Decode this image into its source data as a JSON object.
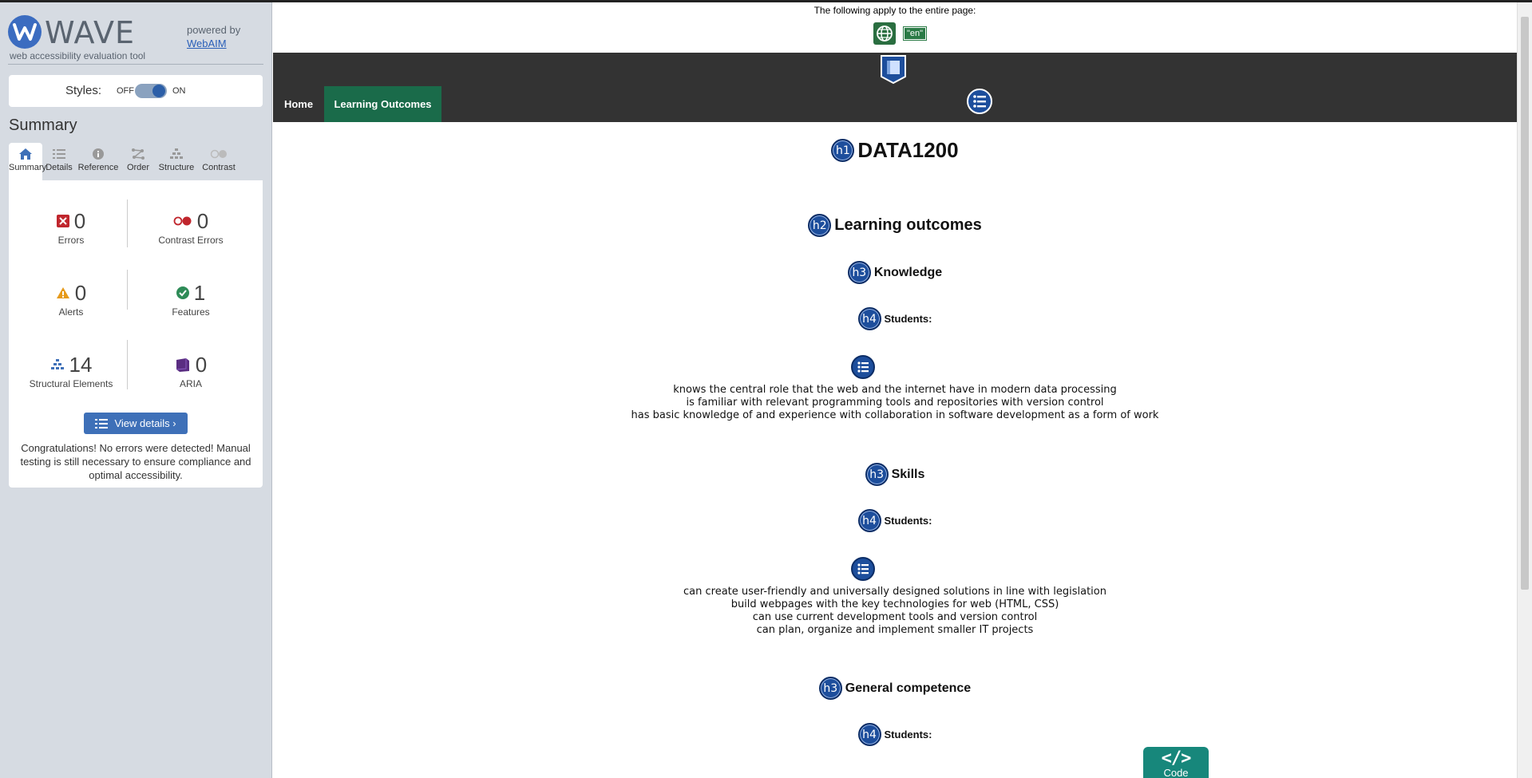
{
  "sidebar": {
    "logo_title": "WAVE",
    "logo_subtitle": "web accessibility evaluation tool",
    "powered_by": "powered by",
    "webaim_link": "WebAIM",
    "styles_label": "Styles:",
    "styles_off": "OFF",
    "styles_on": "ON",
    "summary_heading": "Summary",
    "tabs": [
      {
        "label": "Summary",
        "icon": "home-icon"
      },
      {
        "label": "Details",
        "icon": "details-list-icon"
      },
      {
        "label": "Reference",
        "icon": "info-icon"
      },
      {
        "label": "Order",
        "icon": "order-icon"
      },
      {
        "label": "Structure",
        "icon": "structure-icon"
      },
      {
        "label": "Contrast",
        "icon": "contrast-icon"
      }
    ],
    "stats": {
      "errors": {
        "value": "0",
        "label": "Errors"
      },
      "contrast_errors": {
        "value": "0",
        "label": "Contrast Errors"
      },
      "alerts": {
        "value": "0",
        "label": "Alerts"
      },
      "features": {
        "value": "1",
        "label": "Features"
      },
      "structural": {
        "value": "14",
        "label": "Structural Elements"
      },
      "aria": {
        "value": "0",
        "label": "ARIA"
      }
    },
    "view_details": "View details ›",
    "congrats": "Congratulations! No errors were detected! Manual testing is still necessary to ensure compliance and optimal accessibility."
  },
  "page": {
    "lang_notice": "The following apply to the entire page:",
    "lang_badge": "\"en\"",
    "nav": {
      "home": "Home",
      "learning_outcomes": "Learning Outcomes"
    },
    "h1": {
      "badge": "h1",
      "text": "DATA1200"
    },
    "h2": {
      "badge": "h2",
      "text": "Learning outcomes"
    },
    "knowledge": {
      "badge": "h3",
      "text": "Knowledge"
    },
    "knowledge_students": {
      "badge": "h4",
      "text": "Students:"
    },
    "knowledge_items": [
      "knows the central role that the web and the internet have in modern data processing",
      "is familiar with relevant programming tools and repositories with version control",
      "has basic knowledge of and experience with collaboration in software development as a form of work"
    ],
    "skills": {
      "badge": "h3",
      "text": "Skills"
    },
    "skills_students": {
      "badge": "h4",
      "text": "Students:"
    },
    "skills_items": [
      "can create user-friendly and universally designed solutions in line with legislation",
      "build webpages with the key technologies for web (HTML, CSS)",
      "can use current development tools and version control",
      "can plan, organize and implement smaller IT projects"
    ],
    "general": {
      "badge": "h3",
      "text": "General competence"
    },
    "general_students": {
      "badge": "h4",
      "text": "Students:"
    },
    "code_icon": "</>",
    "code_label": "Code"
  },
  "colors": {
    "wave_blue": "#3b6cc0",
    "nav_dark": "#333333",
    "nav_active": "#1a6b4a",
    "heading_badge": "#1d4e9c",
    "code_tab": "#17877b"
  }
}
